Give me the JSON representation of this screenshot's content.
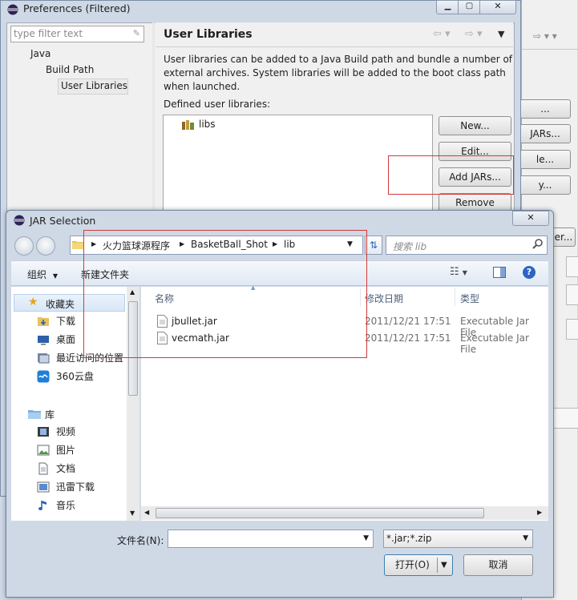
{
  "prefs": {
    "title": "Preferences (Filtered)",
    "filter_placeholder": "type filter text",
    "tree": [
      "Java",
      "Build Path",
      "User Libraries"
    ],
    "page_title": "User Libraries",
    "description": "User libraries can be added to a Java Build path and bundle a number of external archives. System libraries will be added to the boot class path when launched.",
    "defined_label": "Defined user libraries:",
    "library": "libs",
    "buttons": {
      "new": "New...",
      "edit": "Edit...",
      "add_jars": "Add JARs...",
      "remove": "Remove"
    }
  },
  "bg_window": {
    "buttons": [
      "...",
      "JARs...",
      "le...",
      "y...",
      "er..."
    ]
  },
  "jar_dialog": {
    "title": "JAR Selection",
    "breadcrumb": [
      "火力篮球源程序",
      "BasketBall_Shot",
      "lib"
    ],
    "search_placeholder": "搜索 lib",
    "toolbar": {
      "organize": "组织",
      "new_folder": "新建文件夹"
    },
    "nav_favorites_header": "收藏夹",
    "nav_favorites": [
      "下载",
      "桌面",
      "最近访问的位置",
      "360云盘"
    ],
    "nav_library_header": "库",
    "nav_library": [
      "视频",
      "图片",
      "文档",
      "迅雷下载",
      "音乐"
    ],
    "columns": {
      "name": "名称",
      "date": "修改日期",
      "type": "类型"
    },
    "files": [
      {
        "name": "jbullet.jar",
        "date": "2011/12/21 17:51",
        "type": "Executable Jar File"
      },
      {
        "name": "vecmath.jar",
        "date": "2011/12/21 17:51",
        "type": "Executable Jar File"
      }
    ],
    "filename_label": "文件名(N):",
    "filename_value": "",
    "file_type": "*.jar;*.zip",
    "open_button": "打开(O)",
    "cancel_button": "取消"
  },
  "colors": {
    "highlight_box": "#d23a3a",
    "selection": "#dae6f5",
    "window_frame": "#cfd9e6"
  }
}
